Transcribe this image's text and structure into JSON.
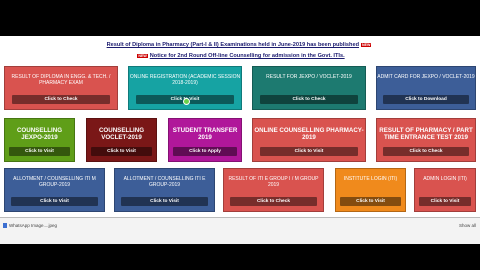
{
  "notices": {
    "line1": "Result of Diploma in Pharmacy (Part-I & II) Examinations held in June-2019 has been published",
    "line2": "Notice for 2nd Round Off-line Counselling for admission in the Govt. ITIs."
  },
  "cards": [
    {
      "id": "diploma-result",
      "color": "#d9534f",
      "title": "Result of Diploma in Engg. & Tech. / Pharmacy Exam",
      "button": "Click to Check"
    },
    {
      "id": "online-registration",
      "color": "#16a3a3",
      "title": "Online Registration (Academic Session 2018-2019)",
      "button": "Click to Visit"
    },
    {
      "id": "jexpo-voclet-result",
      "color": "#1d7a70",
      "title": "Result for JEXPO / VOCLET-2019",
      "button": "Click to Check"
    },
    {
      "id": "admit-card",
      "color": "#3d5e98",
      "title": "Admit Card for JEXPO / VOCLET-2019",
      "button": "Click to Download"
    },
    {
      "id": "counselling-jexpo",
      "color": "#5f9e18",
      "title": "Counselling JEXPO-2019",
      "button": "Click to Visit",
      "big": true
    },
    {
      "id": "counselling-voclet",
      "color": "#7a1717",
      "title": "Counselling VOCLET-2019",
      "button": "Click to Visit",
      "big": true
    },
    {
      "id": "student-transfer",
      "color": "#b0179a",
      "title": "Student Transfer 2019",
      "button": "Click to Apply",
      "big": true
    },
    {
      "id": "online-counselling-pharmacy",
      "color": "#d9534f",
      "title": "Online Counselling Pharmacy-2019",
      "button": "Click to Visit",
      "big": true
    },
    {
      "id": "pharmacy-entrance-result",
      "color": "#d9534f",
      "title": "Result of Pharmacy / Part Time Entrance Test 2019",
      "button": "Click to Check",
      "big": true
    },
    {
      "id": "allotment-iti-group",
      "color": "#3d5e98",
      "title": "Allotment / Counselling ITI M Group-2019",
      "button": "Click to Visit"
    },
    {
      "id": "allotment-iti-e-group",
      "color": "#3d5e98",
      "title": "Allotment / Counselling ITI E Group-2019",
      "button": "Click to Visit"
    },
    {
      "id": "result-iti-group-1",
      "color": "#d9534f",
      "title": "Result of ITI E Group I / M Group 2019",
      "button": "Click to Check"
    },
    {
      "id": "institute-login",
      "color": "#f08a1c",
      "title": "Institute Login (ITI)",
      "button": "Click to Visit"
    },
    {
      "id": "admin-login",
      "color": "#d9534f",
      "title": "Admin Login (ITI)",
      "button": "Click to Visit"
    }
  ],
  "download_bar": {
    "file_name": "WhatsApp Image....jpeg",
    "show_all": "Show all"
  },
  "colors": {
    "notice_text": "#1a1a6e",
    "cursor": "#6ad14a"
  }
}
